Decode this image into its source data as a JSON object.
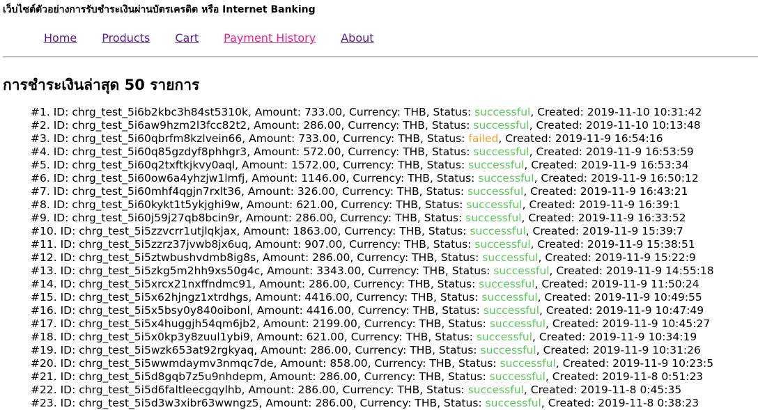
{
  "site": {
    "title": "เว็บไซต์ตัวอย่างการรับชำระเงินผ่านบัตรเครดิต หรือ Internet Banking"
  },
  "nav": {
    "items": [
      {
        "label": "Home",
        "name": "nav-link-home",
        "active": false
      },
      {
        "label": "Products",
        "name": "nav-link-products",
        "active": false
      },
      {
        "label": "Cart",
        "name": "nav-link-cart",
        "active": false
      },
      {
        "label": "Payment History",
        "name": "nav-link-payment-history",
        "active": true
      },
      {
        "label": "About",
        "name": "nav-link-about",
        "active": false
      }
    ]
  },
  "main": {
    "heading": "การชำระเงินล่าสุด 50 รายการ",
    "labels": {
      "id": "ID:",
      "amount": "Amount:",
      "currency": "Currency:",
      "status": "Status:",
      "created": "Created:"
    },
    "colors": {
      "successful": "#5cc85c",
      "failed": "#f0a030",
      "active_link": "#e0218a",
      "link": "#551a8b"
    },
    "payments": [
      {
        "index": "#1.",
        "id": "chrg_test_5i6b2kbc3h84st5310k",
        "amount": "733.00",
        "currency": "THB",
        "status": "successful",
        "created": "2019-11-10 10:31:42"
      },
      {
        "index": "#2.",
        "id": "chrg_test_5i6aw9hzm2l3fcc82t2",
        "amount": "286.00",
        "currency": "THB",
        "status": "successful",
        "created": "2019-11-10 10:13:48"
      },
      {
        "index": "#3.",
        "id": "chrg_test_5i60qbrfm8kzlvein66",
        "amount": "733.00",
        "currency": "THB",
        "status": "failed",
        "created": "2019-11-9 16:54:16"
      },
      {
        "index": "#4.",
        "id": "chrg_test_5i60q85gzdyf8phhgr3",
        "amount": "572.00",
        "currency": "THB",
        "status": "successful",
        "created": "2019-11-9 16:53:59"
      },
      {
        "index": "#5.",
        "id": "chrg_test_5i60q2txftkjkvy0aql",
        "amount": "1572.00",
        "currency": "THB",
        "status": "successful",
        "created": "2019-11-9 16:53:34"
      },
      {
        "index": "#6.",
        "id": "chrg_test_5i60ow6a4yhzjw1lmfj",
        "amount": "1146.00",
        "currency": "THB",
        "status": "successful",
        "created": "2019-11-9 16:50:12"
      },
      {
        "index": "#7.",
        "id": "chrg_test_5i60mhf4qgjn7rxlt36",
        "amount": "326.00",
        "currency": "THB",
        "status": "successful",
        "created": "2019-11-9 16:43:21"
      },
      {
        "index": "#8.",
        "id": "chrg_test_5i60kykt1t5ykjghi9w",
        "amount": "621.00",
        "currency": "THB",
        "status": "successful",
        "created": "2019-11-9 16:39:1"
      },
      {
        "index": "#9.",
        "id": "chrg_test_5i60j59j27qb8bcin9r",
        "amount": "286.00",
        "currency": "THB",
        "status": "successful",
        "created": "2019-11-9 16:33:52"
      },
      {
        "index": "#10.",
        "id": "chrg_test_5i5zzvcrr1utjlqkjax",
        "amount": "1863.00",
        "currency": "THB",
        "status": "successful",
        "created": "2019-11-9 15:39:7"
      },
      {
        "index": "#11.",
        "id": "chrg_test_5i5zzrz37jvwb8jx6uq",
        "amount": "907.00",
        "currency": "THB",
        "status": "successful",
        "created": "2019-11-9 15:38:51"
      },
      {
        "index": "#12.",
        "id": "chrg_test_5i5ztwbushvdmb8ig8s",
        "amount": "286.00",
        "currency": "THB",
        "status": "successful",
        "created": "2019-11-9 15:22:9"
      },
      {
        "index": "#13.",
        "id": "chrg_test_5i5zkg5m2hh9xs50g4c",
        "amount": "3343.00",
        "currency": "THB",
        "status": "successful",
        "created": "2019-11-9 14:55:18"
      },
      {
        "index": "#14.",
        "id": "chrg_test_5i5xrcx21nxffndmc91",
        "amount": "286.00",
        "currency": "THB",
        "status": "successful",
        "created": "2019-11-9 11:50:24"
      },
      {
        "index": "#15.",
        "id": "chrg_test_5i5x62hjngz1xtrdhgs",
        "amount": "4416.00",
        "currency": "THB",
        "status": "successful",
        "created": "2019-11-9 10:49:55"
      },
      {
        "index": "#16.",
        "id": "chrg_test_5i5x5bsy0y840oibonl",
        "amount": "4416.00",
        "currency": "THB",
        "status": "successful",
        "created": "2019-11-9 10:47:49"
      },
      {
        "index": "#17.",
        "id": "chrg_test_5i5x4huggjh54qm6jb2",
        "amount": "2199.00",
        "currency": "THB",
        "status": "successful",
        "created": "2019-11-9 10:45:27"
      },
      {
        "index": "#18.",
        "id": "chrg_test_5i5x0kp3y8zuul1ybi9",
        "amount": "621.00",
        "currency": "THB",
        "status": "successful",
        "created": "2019-11-9 10:34:19"
      },
      {
        "index": "#19.",
        "id": "chrg_test_5i5wzk653at92rgkyaq",
        "amount": "286.00",
        "currency": "THB",
        "status": "successful",
        "created": "2019-11-9 10:31:26"
      },
      {
        "index": "#20.",
        "id": "chrg_test_5i5wwmdaymv3nmqc7de",
        "amount": "858.00",
        "currency": "THB",
        "status": "successful",
        "created": "2019-11-9 10:23:5"
      },
      {
        "index": "#21.",
        "id": "chrg_test_5i5d8gqb7z5u9nhdepm",
        "amount": "286.00",
        "currency": "THB",
        "status": "successful",
        "created": "2019-11-8 0:51:23"
      },
      {
        "index": "#22.",
        "id": "chrg_test_5i5d6faltleecgqylhb",
        "amount": "286.00",
        "currency": "THB",
        "status": "successful",
        "created": "2019-11-8 0:45:35"
      },
      {
        "index": "#23.",
        "id": "chrg_test_5i5d3w3xibr63wwngz5",
        "amount": "286.00",
        "currency": "THB",
        "status": "successful",
        "created": "2019-11-8 0:38:23"
      }
    ]
  }
}
